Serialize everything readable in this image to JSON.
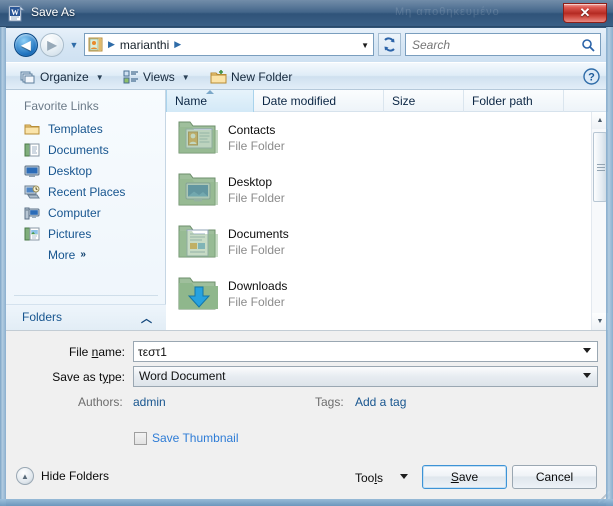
{
  "window": {
    "title": "Save As",
    "title_icon": "word-document-icon",
    "ghost_text": "Μη αποθηκευμένο",
    "close_label": "✕"
  },
  "navbar": {
    "back_icon": "back-arrow-icon",
    "back_glyph": "◀",
    "forward_icon": "forward-arrow-icon",
    "forward_glyph": "▶",
    "recent_dropdown_glyph": "▼",
    "address_icon": "user-folder-icon",
    "crumb_sep": "▶",
    "breadcrumb": [
      "marianthi"
    ],
    "address_dropdown_glyph": "▼",
    "refresh_icon": "refresh-icon",
    "search": {
      "placeholder": "Search",
      "value": "",
      "icon": "search-icon"
    }
  },
  "toolbar": {
    "organize_label": "Organize",
    "organize_icon": "organize-stack-icon",
    "views_label": "Views",
    "views_icon": "views-list-icon",
    "new_folder_label": "New Folder",
    "new_folder_icon": "new-folder-icon",
    "caret_glyph": "▼",
    "help_icon": "help-question-icon"
  },
  "sidebar": {
    "header": "Favorite Links",
    "items": [
      {
        "label": "Templates",
        "icon": "folder-icon"
      },
      {
        "label": "Documents",
        "icon": "documents-icon"
      },
      {
        "label": "Desktop",
        "icon": "desktop-icon"
      },
      {
        "label": "Recent Places",
        "icon": "recent-places-icon"
      },
      {
        "label": "Computer",
        "icon": "computer-icon"
      },
      {
        "label": "Pictures",
        "icon": "pictures-icon"
      }
    ],
    "more_label": "More",
    "more_chevron": "»",
    "folders_label": "Folders",
    "folders_chevron": "︿"
  },
  "filelist": {
    "columns": [
      {
        "label": "Name",
        "sorted": true,
        "sort": "asc"
      },
      {
        "label": "Date modified",
        "sorted": false
      },
      {
        "label": "Size",
        "sorted": false
      },
      {
        "label": "Folder path",
        "sorted": false
      }
    ],
    "rows": [
      {
        "name": "Contacts",
        "type": "File Folder",
        "icon": "contacts-folder-icon"
      },
      {
        "name": "Desktop",
        "type": "File Folder",
        "icon": "desktop-folder-icon"
      },
      {
        "name": "Documents",
        "type": "File Folder",
        "icon": "documents-folder-icon"
      },
      {
        "name": "Downloads",
        "type": "File Folder",
        "icon": "downloads-folder-icon"
      }
    ],
    "scrollbar": {
      "up_glyph": "▲",
      "down_glyph": "▼"
    }
  },
  "form": {
    "filename_label_pre": "File ",
    "filename_label_accel": "n",
    "filename_label_post": "ame:",
    "filename_value": "τεστ1",
    "savetype_label_pre": "Save as t",
    "savetype_label_accel": "y",
    "savetype_label_post": "pe:",
    "savetype_value": "Word Document",
    "authors_label": "Authors:",
    "authors_value": "admin",
    "tags_label": "Tags:",
    "tags_value": "Add a tag",
    "thumbnail_label": "Save Thumbnail",
    "thumbnail_checked": false
  },
  "footer": {
    "hide_folders_label": "Hide Folders",
    "hide_folders_glyph": "▲",
    "tools_label_pre": "Too",
    "tools_label_accel": "l",
    "tools_label_post": "s",
    "save_label_pre": "",
    "save_label_accel": "S",
    "save_label_post": "ave",
    "cancel_label": "Cancel"
  },
  "colors": {
    "title_bar": "#3b5f85",
    "link_blue": "#17558f",
    "accent_blue": "#2e7cd6",
    "close_red": "#b42a22",
    "selected_column": "#d3e9f7"
  }
}
